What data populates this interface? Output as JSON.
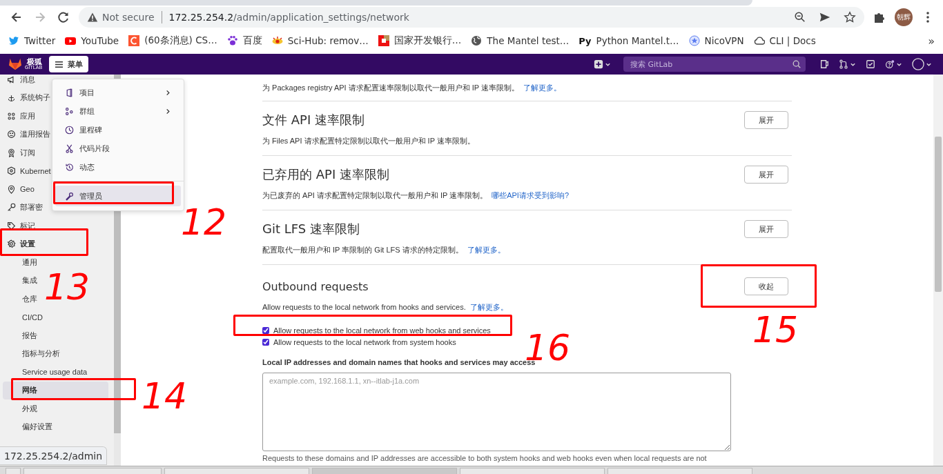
{
  "browser": {
    "security_label": "Not secure",
    "url_host": "172.25.254.2",
    "url_path": "/admin/application_settings/network",
    "profile_label": "朝辉",
    "bookmarks_overflow": "»",
    "bookmarks": [
      {
        "title": "Twitter"
      },
      {
        "title": "YouTube"
      },
      {
        "title": "(60条消息) CS…"
      },
      {
        "title": "百度"
      },
      {
        "title": "Sci-Hub: remov…"
      },
      {
        "title": "国家开发银行…"
      },
      {
        "title": "The Mantel test…"
      },
      {
        "title": "Python Mantel.t…",
        "icon_text": "Py"
      },
      {
        "title": "NicoVPN"
      },
      {
        "title": "CLI | Docs"
      }
    ]
  },
  "header": {
    "logo_text": "极狐",
    "logo_subtext": "GITLAB",
    "menu_label": "菜单",
    "search_placeholder": "搜索 GitLab"
  },
  "sidebar": {
    "items": [
      {
        "label": "消息"
      },
      {
        "label": "系统钩子"
      },
      {
        "label": "应用"
      },
      {
        "label": "滥用报告"
      },
      {
        "label": "订阅"
      },
      {
        "label": "Kubernet"
      },
      {
        "label": "Geo"
      },
      {
        "label": "部署密"
      },
      {
        "label": "标记"
      },
      {
        "label": "设置",
        "children": [
          {
            "label": "通用",
            "selected": false
          },
          {
            "label": "集成",
            "selected": false
          },
          {
            "label": "仓库",
            "selected": false
          },
          {
            "label": "CI/CD",
            "selected": false
          },
          {
            "label": "报告",
            "selected": false
          },
          {
            "label": "指标与分析",
            "selected": false
          },
          {
            "label": "Service usage data",
            "selected": false
          },
          {
            "label": "网络",
            "selected": true
          },
          {
            "label": "外观",
            "selected": false
          },
          {
            "label": "偏好设置",
            "selected": false
          }
        ]
      }
    ]
  },
  "menu": {
    "items": [
      {
        "label": "项目",
        "submenu": true,
        "selected": false
      },
      {
        "label": "群组",
        "submenu": true,
        "selected": false
      },
      {
        "label": "里程碑",
        "submenu": false,
        "selected": false
      },
      {
        "label": "代码片段",
        "submenu": false,
        "selected": false
      },
      {
        "label": "动态",
        "submenu": false,
        "selected": false
      },
      {
        "label": "管理员",
        "submenu": false,
        "selected": true
      }
    ]
  },
  "sections": [
    {
      "description": "为 Packages registry API 请求配置速率限制以取代一般用户和 IP 速率限制。",
      "link": "了解更多。"
    },
    {
      "title": "文件 API 速率限制",
      "description": "为 Files API 请求配置特定限制以取代一般用户和 IP 速率限制。",
      "button": "展开"
    },
    {
      "title": "已弃用的 API 速率限制",
      "description": "为已废弃的 API 请求配置特定限制以取代一般用户和 IP 速率限制。",
      "link": "哪些API请求受到影响?",
      "button": "展开"
    },
    {
      "title": "Git LFS 速率限制",
      "description": "配置取代一般用户和 IP 率限制的 Git LFS 请求的特定限制。",
      "link": "了解更多。",
      "button": "展开"
    }
  ],
  "outbound": {
    "title": "Outbound requests",
    "description": "Allow requests to the local network from hooks and services.",
    "link": "了解更多。",
    "button": "收起",
    "checkboxes": [
      {
        "label": "Allow requests to the local network from web hooks and services",
        "checked": true
      },
      {
        "label": "Allow requests to the local network from system hooks",
        "checked": true
      }
    ],
    "allowlist_label": "Local IP addresses and domain names that hooks and services may access",
    "allowlist_placeholder": "example.com, 192.168.1.1, xn--itlab-j1a.com",
    "help": "Requests to these domains and IP addresses are accessible to both system hooks and web hooks even when local requests are not"
  },
  "status_url": "172.25.254.2/admin",
  "annotations": [
    {
      "label": "12"
    },
    {
      "label": "13"
    },
    {
      "label": "14"
    },
    {
      "label": "15"
    },
    {
      "label": "16"
    }
  ]
}
